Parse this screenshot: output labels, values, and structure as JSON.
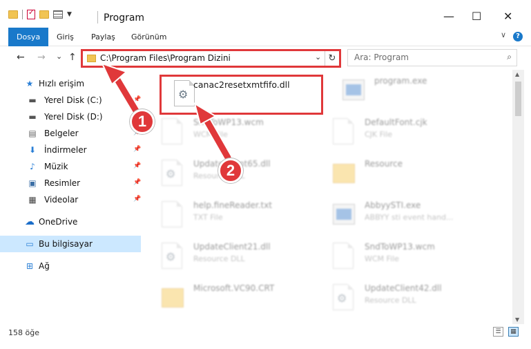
{
  "window": {
    "title": "Program",
    "minimize": "—",
    "maximize": "☐",
    "close": "✕"
  },
  "ribbon": {
    "tabs": [
      "Dosya",
      "Giriş",
      "Paylaş",
      "Görünüm"
    ],
    "help": "?",
    "expand": "∨"
  },
  "nav": {
    "back": "←",
    "forward": "→",
    "recent": "⌄",
    "up": "↑",
    "address": "C:\\Program Files\\Program Dizini",
    "dropdown": "⌄",
    "refresh": "↻",
    "search_placeholder": "Ara: Program",
    "search_icon": "⌕"
  },
  "sidebar": {
    "items": [
      {
        "label": "Hızlı erişim",
        "icon": "★"
      },
      {
        "label": "Yerel Disk (C:)",
        "icon": "▬"
      },
      {
        "label": "Yerel Disk (D:)",
        "icon": "▬"
      },
      {
        "label": "Belgeler",
        "icon": "▤"
      },
      {
        "label": "İndirmeler",
        "icon": "⬇"
      },
      {
        "label": "Müzik",
        "icon": "♪"
      },
      {
        "label": "Resimler",
        "icon": "▣"
      },
      {
        "label": "Videolar",
        "icon": "▦"
      },
      {
        "label": "OneDrive",
        "icon": "☁"
      },
      {
        "label": "Bu bilgisayar",
        "icon": "▭"
      },
      {
        "label": "Ağ",
        "icon": "⊞"
      }
    ],
    "pin": "📌"
  },
  "files": [
    {
      "name": "canac2resetxmtfifo.dll",
      "type": ""
    },
    {
      "name": "program.exe",
      "type": ""
    },
    {
      "name": "SndToWP13.wcm",
      "type": "WCM File"
    },
    {
      "name": "DefaultFont.cjk",
      "type": "CJK File"
    },
    {
      "name": "UpdateClient65.dll",
      "type": "Resource DLL"
    },
    {
      "name": "Resource",
      "type": ""
    },
    {
      "name": "help.fineReader.txt",
      "type": "TXT File"
    },
    {
      "name": "AbbyySTI.exe",
      "type": "ABBYY sti event hand..."
    },
    {
      "name": "UpdateClient21.dll",
      "type": "Resource DLL"
    },
    {
      "name": "SndToWP13.wcm",
      "type": "WCM File"
    },
    {
      "name": "Microsoft.VC90.CRT",
      "type": ""
    },
    {
      "name": "UpdateClient42.dll",
      "type": "Resource DLL"
    }
  ],
  "annotations": {
    "badge1": "1",
    "badge2": "2"
  },
  "status": {
    "count": "158 öğe"
  },
  "colors": {
    "accent": "#1979ca",
    "highlight": "#e0383a",
    "selection": "#cce8ff"
  }
}
